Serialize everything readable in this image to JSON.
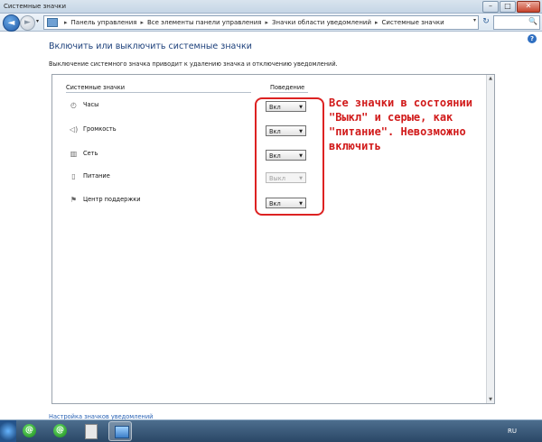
{
  "window": {
    "title": "Системные значки",
    "controls": {
      "minimize": "–",
      "maximize": "□",
      "close": "✕"
    }
  },
  "nav": {
    "back_glyph": "◄",
    "forward_glyph": "►",
    "dropdown_glyph": "▾",
    "breadcrumb": [
      "Панель управления",
      "Все элементы панели управления",
      "Значки области уведомлений",
      "Системные значки"
    ],
    "separator": "▸",
    "refresh_glyph": "↻",
    "search_glyph": "🔍"
  },
  "help_glyph": "?",
  "heading": "Включить или выключить системные значки",
  "description": "Выключение системного значка приводит к удалению значка и отключению уведомлений.",
  "table": {
    "col_icons": "Системные значки",
    "col_behavior": "Поведение",
    "rows": [
      {
        "icon": "clock-icon",
        "glyph": "◴",
        "label": "Часы",
        "value": "Вкл",
        "enabled": true
      },
      {
        "icon": "volume-icon",
        "glyph": "◁)",
        "label": "Громкость",
        "value": "Вкл",
        "enabled": true
      },
      {
        "icon": "network-icon",
        "glyph": "▥",
        "label": "Сеть",
        "value": "Вкл",
        "enabled": true
      },
      {
        "icon": "power-icon",
        "glyph": "▯",
        "label": "Питание",
        "value": "Выкл",
        "enabled": false
      },
      {
        "icon": "action-center-icon",
        "glyph": "⚑",
        "label": "Центр поддержки",
        "value": "Вкл",
        "enabled": true
      }
    ],
    "combo_arrow": "▼"
  },
  "annotation": {
    "text": "Все значки в состоянии \"Выкл\" и серые, как \"питание\". Невозможно включить",
    "color": "#d11a1a"
  },
  "bottom_link": "Настройка значков уведомлений",
  "taskbar": {
    "lang": "RU",
    "app_glyph": "@"
  }
}
